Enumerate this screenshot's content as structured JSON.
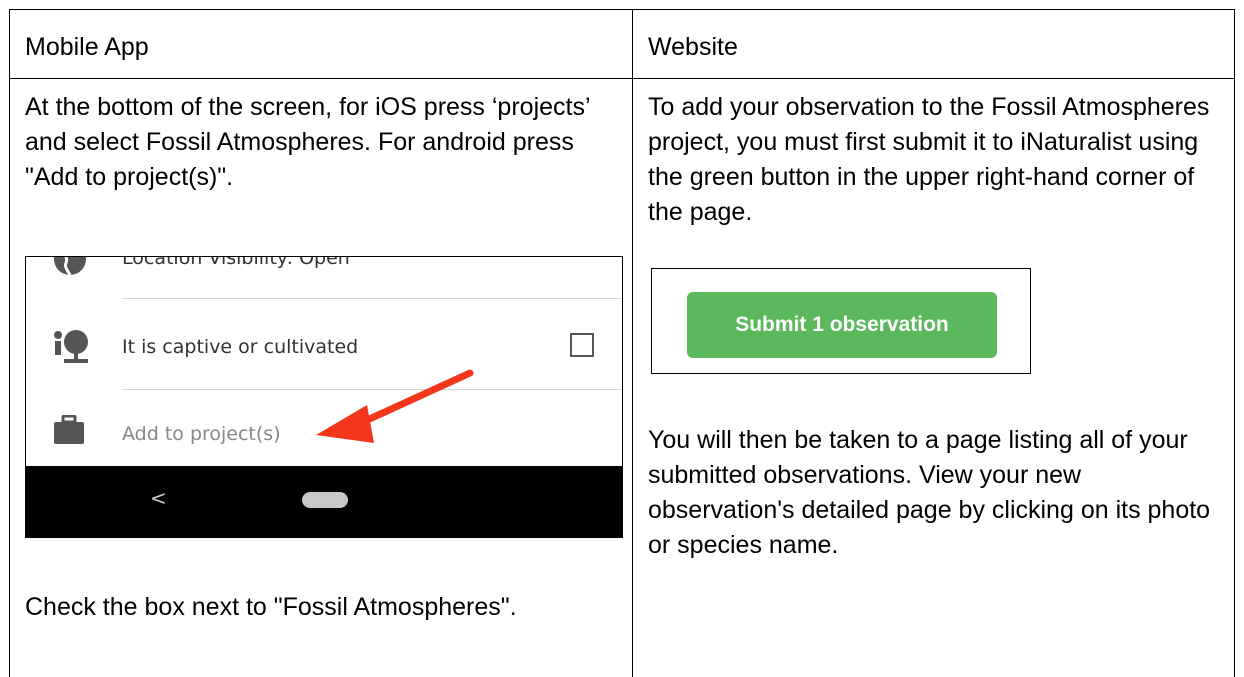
{
  "table": {
    "headers": [
      "Mobile App",
      "Website"
    ],
    "mobile": {
      "intro": "At the bottom of the screen, for iOS press ‘projects’ and select Fossil Atmospheres. For android press \"Add to project(s)\".",
      "outro": "Check the box next to \"Fossil Atmospheres\".",
      "screenshot": {
        "row_location": "Location Visibility: Open",
        "row_captive": "It is captive or cultivated",
        "row_add": "Add to project(s)",
        "nav_back_glyph": "<",
        "icons": [
          "globe-icon",
          "tree-person-icon",
          "briefcase-icon",
          "checkbox-icon",
          "arrow-icon"
        ],
        "arrow_color": "#f3361c"
      }
    },
    "website": {
      "intro": "To add your observation to the Fossil Atmospheres project, you must first submit it to iNaturalist using the green button in the upper right-hand corner of the page.",
      "button_label": "Submit 1 observation",
      "button_color": "#5cb85c",
      "outro": "You will then be taken to a page listing all of your submitted observations.  View your new observation's detailed page by clicking on its photo or species name."
    }
  }
}
